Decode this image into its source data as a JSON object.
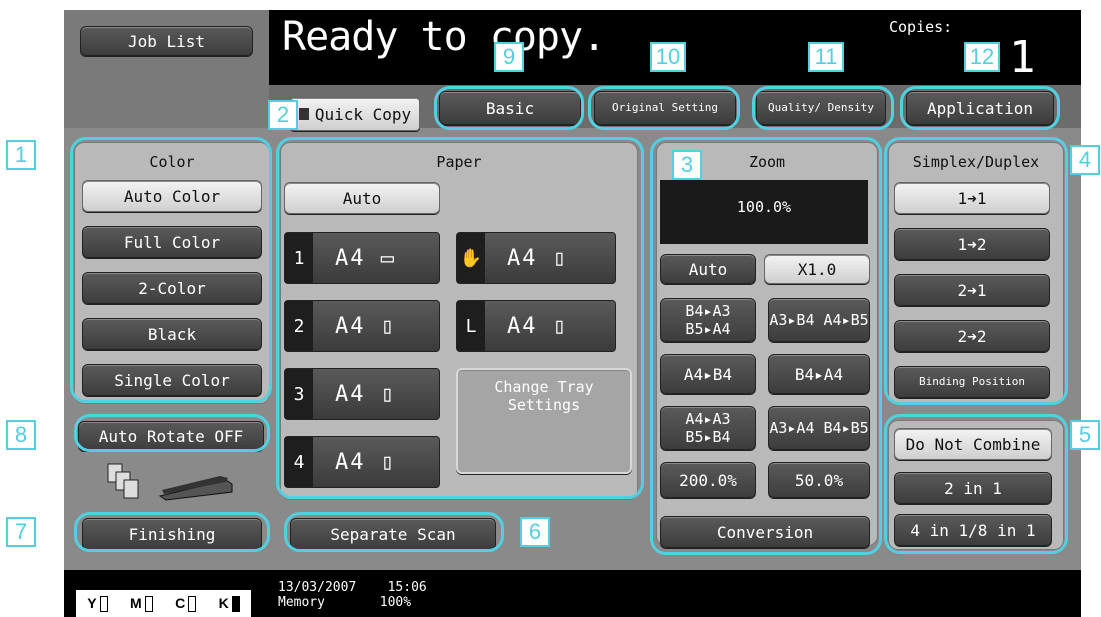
{
  "header": {
    "job_list": "Job List",
    "status": "Ready to copy.",
    "copies_label": "Copies:",
    "copies_value": "1"
  },
  "tabs": {
    "quick_copy": "Quick Copy",
    "basic": "Basic",
    "original_setting": "Original Setting",
    "quality_density": "Quality/ Density",
    "application": "Application"
  },
  "color": {
    "title": "Color",
    "auto_color": "Auto Color",
    "full_color": "Full Color",
    "two_color": "2-Color",
    "black": "Black",
    "single_color": "Single Color"
  },
  "paper": {
    "title": "Paper",
    "auto": "Auto",
    "trays": [
      {
        "num": "1",
        "size": "A4 ▭"
      },
      {
        "num": "2",
        "size": "A4 ▯"
      },
      {
        "num": "3",
        "size": "A4 ▯"
      },
      {
        "num": "4",
        "size": "A4 ▯"
      },
      {
        "num": "✋",
        "size": "A4 ▯"
      },
      {
        "num": "L",
        "size": "A4 ▯"
      }
    ],
    "change_tray": "Change Tray Settings"
  },
  "zoom": {
    "title": "Zoom",
    "value": "100.0%",
    "auto": "Auto",
    "x1": "X1.0",
    "presets": [
      "B4▸A3 B5▸A4",
      "A3▸B4 A4▸B5",
      "A4▸B4",
      "B4▸A4",
      "A4▸A3 B5▸B4",
      "A3▸A4 B4▸B5",
      "200.0%",
      "50.0%"
    ],
    "conversion": "Conversion"
  },
  "duplex": {
    "title": "Simplex/Duplex",
    "options": [
      "1➜1",
      "1➜2",
      "2➜1",
      "2➜2"
    ],
    "binding_position": "Binding Position"
  },
  "combine": {
    "do_not_combine": "Do Not Combine",
    "two_in_one": "2 in 1",
    "four_eight": "4 in 1/8 in 1"
  },
  "bottom_left": {
    "auto_rotate": "Auto Rotate OFF",
    "finishing": "Finishing",
    "separate_scan": "Separate Scan"
  },
  "footer": {
    "date": "13/03/2007",
    "time": "15:06",
    "memory_label": "Memory",
    "memory_value": "100%",
    "toner": [
      "Y",
      "M",
      "C",
      "K"
    ]
  },
  "callouts": [
    "1",
    "2",
    "3",
    "4",
    "5",
    "6",
    "7",
    "8",
    "9",
    "10",
    "11",
    "12"
  ],
  "colors": {
    "highlight": "#52cfe0"
  }
}
